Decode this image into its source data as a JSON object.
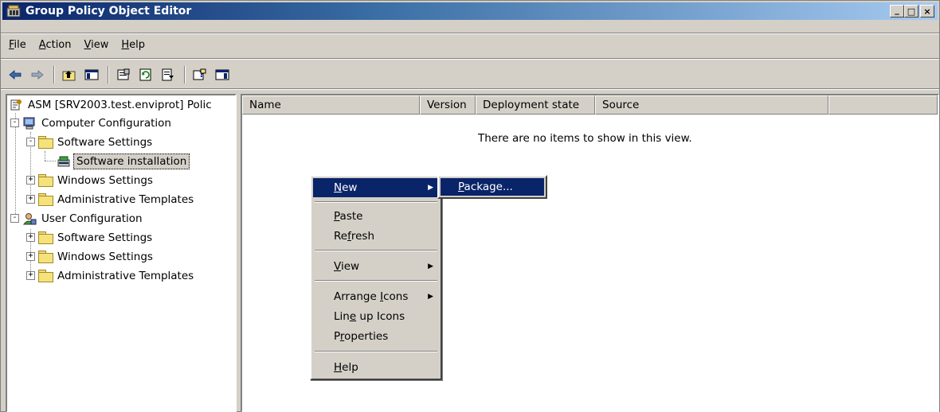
{
  "window": {
    "title": "Group Policy Object Editor",
    "buttons": {
      "minimize": "_",
      "maximize": "□",
      "close": "×"
    }
  },
  "menubar": {
    "items": [
      {
        "label": "File",
        "underline": "F",
        "rest": "ile"
      },
      {
        "label": "Action",
        "underline": "A",
        "rest": "ction"
      },
      {
        "label": "View",
        "underline": "V",
        "rest": "iew"
      },
      {
        "label": "Help",
        "underline": "H",
        "rest": "elp"
      }
    ]
  },
  "toolbar": {
    "icons": [
      "back-arrow-icon",
      "forward-arrow-icon",
      "up-one-level-icon",
      "show-hide-console-tree-icon",
      "properties-icon",
      "refresh-icon",
      "export-list-icon",
      "help-icon",
      "show-hide-action-pane-icon"
    ]
  },
  "tree": {
    "root": "ASM [SRV2003.test.enviprot] Polic",
    "computer_config": "Computer Configuration",
    "cc_software_settings": "Software Settings",
    "cc_software_installation": "Software installation",
    "cc_windows_settings": "Windows Settings",
    "cc_admin_templates": "Administrative Templates",
    "user_config": "User Configuration",
    "uc_software_settings": "Software Settings",
    "uc_windows_settings": "Windows Settings",
    "uc_admin_templates": "Administrative Templates"
  },
  "list": {
    "columns": [
      "Name",
      "Version",
      "Deployment state",
      "Source"
    ],
    "empty_message": "There are no items to show in this view."
  },
  "context_menu": {
    "new": {
      "underline": "N",
      "rest": "ew"
    },
    "paste": {
      "underline": "P",
      "rest": "aste"
    },
    "refresh": {
      "pre": "Re",
      "underline": "f",
      "rest": "resh"
    },
    "view": {
      "underline": "V",
      "rest": "iew"
    },
    "arrange_icons": {
      "pre": "Arrange ",
      "underline": "I",
      "rest": "cons"
    },
    "line_up_icons": {
      "pre": "Lin",
      "underline": "e",
      "rest": " up Icons"
    },
    "properties": {
      "pre": "P",
      "underline": "r",
      "rest": "operties"
    },
    "help": {
      "underline": "H",
      "rest": "elp"
    }
  },
  "submenu": {
    "package": {
      "underline": "P",
      "rest": "ackage..."
    }
  },
  "colors": {
    "title_active": "#0a246a",
    "face": "#d4d0c8",
    "highlight": "#0a246a"
  }
}
